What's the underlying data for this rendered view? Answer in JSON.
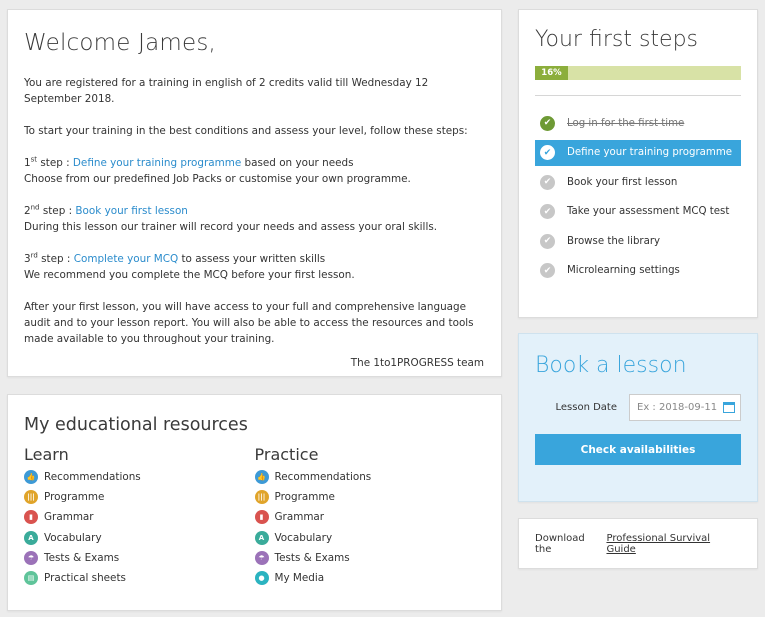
{
  "welcome": {
    "title": "Welcome James,",
    "registered": "You are registered for a training in english of 2 credits valid till Wednesday 12 September 2018.",
    "intro": "To start your training in the best conditions and assess your level, follow these steps:",
    "step1_num": "1",
    "step1_sup": "st",
    "step1_prefix": " step : ",
    "step1_link": "Define your training programme",
    "step1_after": " based on your needs",
    "step1_desc": "Choose from our predefined Job Packs or customise your own programme.",
    "step2_num": "2",
    "step2_sup": "nd",
    "step2_prefix": " step : ",
    "step2_link": "Book your first lesson",
    "step2_desc": "During this lesson our trainer will record your needs and assess your oral skills.",
    "step3_num": "3",
    "step3_sup": "rd",
    "step3_prefix": " step : ",
    "step3_link": "Complete your MCQ",
    "step3_after": " to assess your written skills",
    "step3_desc": "We recommend you complete the MCQ before your first lesson.",
    "after": "After your first lesson, you will have access to your full and comprehensive language audit and to your lesson report. You will also be able to access the resources and tools made available to you throughout your training.",
    "signature": "The 1to1PROGRESS team"
  },
  "resources": {
    "title": "My educational resources",
    "learn": {
      "heading": "Learn",
      "items": [
        {
          "label": "Recommendations",
          "icon": "thumbs-up-icon",
          "color": "#3d9ad6",
          "glyph": "👍"
        },
        {
          "label": "Programme",
          "icon": "programme-icon",
          "color": "#e0a42a",
          "glyph": "|||"
        },
        {
          "label": "Grammar",
          "icon": "grammar-icon",
          "color": "#d9534f",
          "glyph": "▮"
        },
        {
          "label": "Vocabulary",
          "icon": "vocabulary-icon",
          "color": "#3aab9a",
          "glyph": "A"
        },
        {
          "label": "Tests & Exams",
          "icon": "tests-icon",
          "color": "#9b72b8",
          "glyph": "☂"
        },
        {
          "label": "Practical sheets",
          "icon": "sheets-icon",
          "color": "#5fc49a",
          "glyph": "▤"
        }
      ]
    },
    "practice": {
      "heading": "Practice",
      "items": [
        {
          "label": "Recommendations",
          "icon": "thumbs-up-icon",
          "color": "#3d9ad6",
          "glyph": "👍"
        },
        {
          "label": "Programme",
          "icon": "programme-icon",
          "color": "#e0a42a",
          "glyph": "|||"
        },
        {
          "label": "Grammar",
          "icon": "grammar-icon",
          "color": "#d9534f",
          "glyph": "▮"
        },
        {
          "label": "Vocabulary",
          "icon": "vocabulary-icon",
          "color": "#3aab9a",
          "glyph": "A"
        },
        {
          "label": "Tests & Exams",
          "icon": "tests-icon",
          "color": "#9b72b8",
          "glyph": "☂"
        },
        {
          "label": "My Media",
          "icon": "media-icon",
          "color": "#2bb3c0",
          "glyph": "●"
        }
      ]
    }
  },
  "steps": {
    "title": "Your first steps",
    "progress_label": "16%",
    "progress_value": 16,
    "items": [
      {
        "label": "Log in for the first time",
        "state": "done"
      },
      {
        "label": "Define your training programme",
        "state": "active"
      },
      {
        "label": "Book your first lesson",
        "state": "todo"
      },
      {
        "label": "Take your assessment MCQ test",
        "state": "todo"
      },
      {
        "label": "Browse the library",
        "state": "todo"
      },
      {
        "label": "Microlearning settings",
        "state": "todo"
      }
    ]
  },
  "book": {
    "title": "Book a lesson",
    "date_label": "Lesson Date",
    "date_placeholder": "Ex : 2018-09-11",
    "button": "Check availabilities"
  },
  "download": {
    "prefix": "Download the",
    "link": "Professional Survival Guide"
  },
  "colors": {
    "accent": "#39a5dc",
    "progress_fill": "#8cae3c",
    "progress_track": "#d8e2a6",
    "done_check": "#6e9a35"
  }
}
